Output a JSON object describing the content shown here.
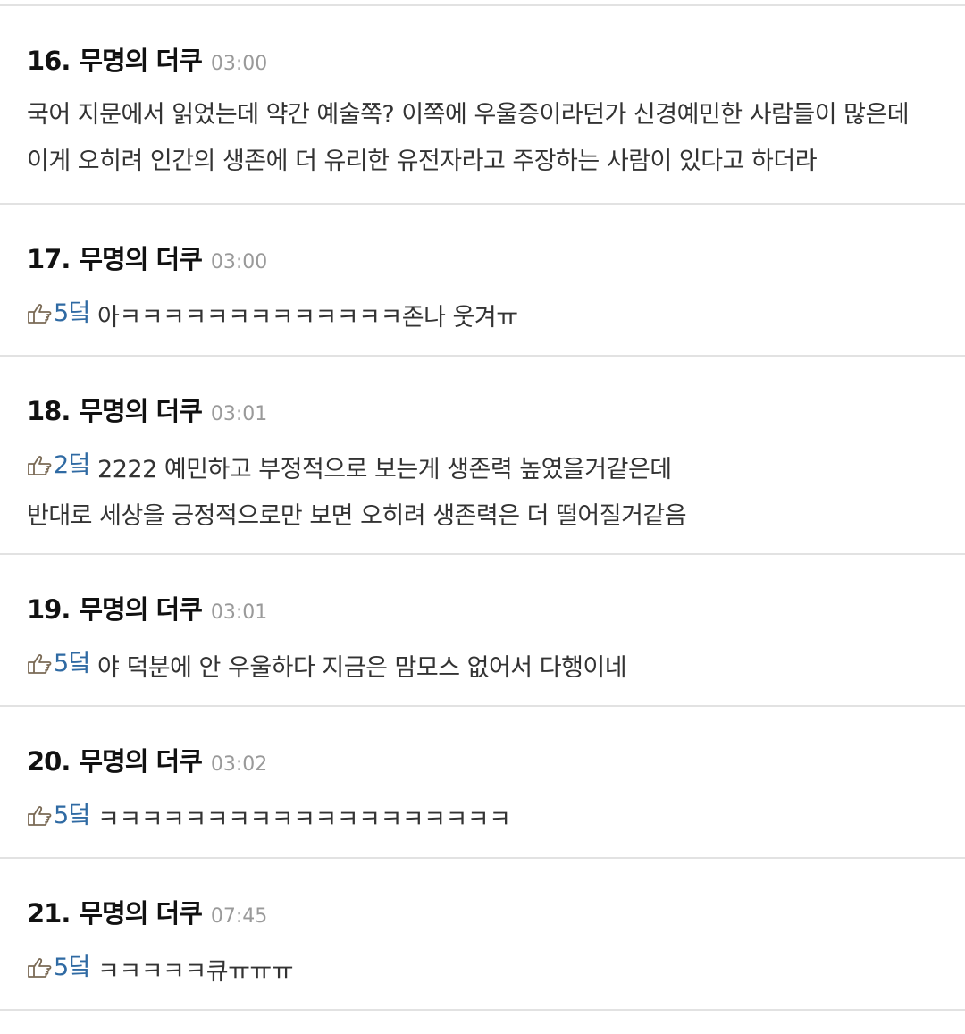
{
  "comments": [
    {
      "number": "16.",
      "author": "무명의 더쿠",
      "time": "03:00",
      "reply_to": null,
      "lines": [
        "국어 지문에서 읽었는데 약간 예술쪽? 이쪽에 우울증이라던가 신경예민한 사람들이 많은데",
        "이게 오히려 인간의 생존에 더 유리한 유전자라고 주장하는 사람이 있다고 하더라"
      ]
    },
    {
      "number": "17.",
      "author": "무명의 더쿠",
      "time": "03:00",
      "reply_to": "5덬",
      "lines": [
        "아ㅋㅋㅋㅋㅋㅋㅋㅋㅋㅋㅋㅋㅋ존나 웃겨ㅠ"
      ]
    },
    {
      "number": "18.",
      "author": "무명의 더쿠",
      "time": "03:01",
      "reply_to": "2덬",
      "lines": [
        "2222 예민하고 부정적으로 보는게 생존력 높였을거같은데",
        "반대로 세상을 긍정적으로만 보면 오히려 생존력은 더 떨어질거같음"
      ]
    },
    {
      "number": "19.",
      "author": "무명의 더쿠",
      "time": "03:01",
      "reply_to": "5덬",
      "lines": [
        "야 덕분에 안 우울하다 지금은 맘모스 없어서 다행이네"
      ]
    },
    {
      "number": "20.",
      "author": "무명의 더쿠",
      "time": "03:02",
      "reply_to": "5덬",
      "lines": [
        "ㅋㅋㅋㅋㅋㅋㅋㅋㅋㅋㅋㅋㅋㅋㅋㅋㅋㅋㅋ"
      ]
    },
    {
      "number": "21.",
      "author": "무명의 더쿠",
      "time": "07:45",
      "reply_to": "5덬",
      "lines": [
        "ㅋㅋㅋㅋㅋ큐ㅠㅠㅠ"
      ]
    }
  ],
  "icons": {
    "reply_ref": "pointing-hand-icon"
  },
  "colors": {
    "reply_ref_text": "#2f6aa3",
    "time_text": "#9a9a9a",
    "divider": "#e2e2e2"
  }
}
